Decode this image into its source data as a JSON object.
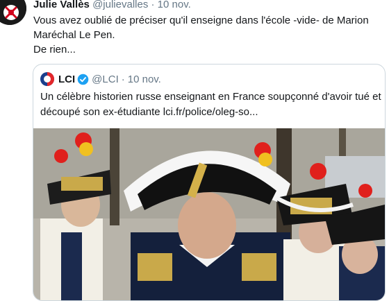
{
  "tweet": {
    "display_name": "Julie Vallès",
    "handle": "@julievalles",
    "separator": "·",
    "date": "10 nov.",
    "text_lines": [
      "Vous avez oublié de préciser qu'il enseigne dans l'école -vide- de Marion",
      "Maréchal Le Pen.",
      "De rien..."
    ]
  },
  "quoted": {
    "logo_label": "LCI",
    "display_name": "LCI",
    "handle": "@LCI",
    "separator": "·",
    "date": "10 nov.",
    "text_lines": [
      "Un célèbre historien russe enseignant en France soupçonné d'avoir tué et",
      "découpé son ex-étudiante lci.fr/police/oleg-so..."
    ]
  },
  "colors": {
    "text": "#14171a",
    "meta": "#657786",
    "border": "#ccd6dd",
    "verified": "#1da1f2"
  },
  "icons": {
    "verified": "verified-badge-icon"
  }
}
